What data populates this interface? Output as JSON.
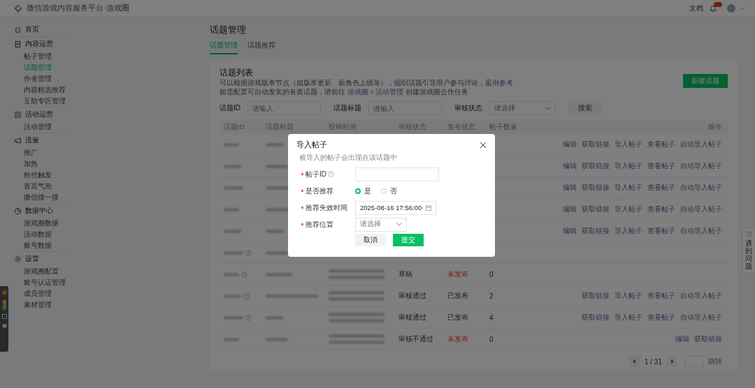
{
  "header": {
    "title": "微信游戏内容服务平台·游戏圈",
    "docs_link": "文档"
  },
  "sidebar": {
    "groups": [
      {
        "label": "首页"
      },
      {
        "label": "内容运营",
        "items": [
          {
            "label": "帖子管理",
            "selected": false
          },
          {
            "label": "话题管理",
            "selected": true
          },
          {
            "label": "作者管理",
            "selected": false
          },
          {
            "label": "内容精选推荐",
            "selected": false
          },
          {
            "label": "互助专区管理",
            "selected": false
          }
        ]
      },
      {
        "label": "活动运营",
        "items": [
          {
            "label": "活动管理",
            "selected": false
          }
        ]
      },
      {
        "label": "流量",
        "items": [
          {
            "label": "推广",
            "selected": false
          },
          {
            "label": "加热",
            "selected": false
          },
          {
            "label": "粉丝触发",
            "selected": false
          },
          {
            "label": "首页气泡",
            "selected": false
          },
          {
            "label": "微信搜一搜",
            "selected": false
          }
        ]
      },
      {
        "label": "数据中心",
        "items": [
          {
            "label": "游戏圈数据",
            "selected": false
          },
          {
            "label": "活动数据",
            "selected": false
          },
          {
            "label": "账号数据",
            "selected": false
          }
        ]
      },
      {
        "label": "设置",
        "items": [
          {
            "label": "游戏圈配置",
            "selected": false
          },
          {
            "label": "账号认证管理",
            "selected": false
          },
          {
            "label": "成员管理",
            "selected": false
          },
          {
            "label": "素材管理",
            "selected": false
          }
        ]
      }
    ]
  },
  "page_title": "话题管理",
  "tabs": [
    {
      "label": "话题管理",
      "selected": true
    },
    {
      "label": "话题推荐",
      "selected": false
    }
  ],
  "card": {
    "title": "话题列表",
    "new_button": "新建话题",
    "description": [
      {
        "text": "可以根据游戏版本节点（如版本更新、新角色上线等），组织话题引导用户参与讨论，",
        "link": "案例参考"
      },
      {
        "text": "如需配置可自动发奖的有奖话题，请前往 ",
        "link": "游戏圈 > 活动管理",
        "after": " 创建游戏圈合作任务"
      }
    ],
    "filters": [
      {
        "kind": "input",
        "label": "话题ID",
        "placeholder": "请输入"
      },
      {
        "kind": "input",
        "label": "话题标题",
        "placeholder": "请输入"
      },
      {
        "kind": "select",
        "label": "审核状态",
        "placeholder": "请选择"
      }
    ],
    "search_button": "搜索",
    "columns": [
      "话题ID",
      "话题标题",
      "投稿时间",
      "审核状态",
      "发布状态",
      "帖子数量",
      "操作"
    ],
    "rows": [
      {
        "help": false,
        "actions": [
          "编辑",
          "获取链接",
          "导入帖子",
          "查看帖子",
          "自动导入帖子"
        ]
      },
      {
        "help": false,
        "actions": [
          "编辑",
          "获取链接",
          "导入帖子",
          "查看帖子",
          "自动导入帖子"
        ]
      },
      {
        "help": false,
        "actions": [
          "编辑",
          "获取链接",
          "导入帖子",
          "查看帖子",
          "自动导入帖子"
        ]
      },
      {
        "help": false,
        "actions": [
          "编辑",
          "获取链接",
          "导入帖子",
          "查看帖子",
          "自动导入帖子"
        ]
      },
      {
        "help": false,
        "actions": [
          "编辑",
          "获取链接",
          "导入帖子",
          "查看帖子",
          "自动导入帖子"
        ]
      },
      {
        "help": true,
        "actions": []
      },
      {
        "help": true,
        "audit": "草稿",
        "publish": "未发布",
        "published": false,
        "count": "0",
        "actions": []
      },
      {
        "help": true,
        "audit": "审核通过",
        "publish": "已发布",
        "published": true,
        "count": "2",
        "actions": [
          "获取链接",
          "导入帖子",
          "查看帖子",
          "自动导入帖子"
        ]
      },
      {
        "help": true,
        "audit": "审核通过",
        "publish": "已发布",
        "published": true,
        "count": "4",
        "actions": [
          "获取链接",
          "导入帖子",
          "查看帖子",
          "自动导入帖子"
        ]
      },
      {
        "help": false,
        "audit": "审核不通过",
        "publish": "未发布",
        "published": false,
        "count": "0",
        "actions": [
          "编辑",
          "获取链接"
        ]
      }
    ],
    "pagination": {
      "page": "1 / 31",
      "jump": "跳转"
    }
  },
  "help_tab": {
    "label": "遇到问题"
  },
  "modal": {
    "title": "导入帖子",
    "hint": "被导入的帖子会出现在该话题中",
    "fields": [
      {
        "kind": "input",
        "label": "帖子ID",
        "required": true,
        "help": true
      },
      {
        "kind": "radio",
        "label": "是否推荐",
        "required": true,
        "options": [
          {
            "label": "是",
            "selected": true
          },
          {
            "label": "否",
            "selected": false
          }
        ]
      },
      {
        "kind": "date",
        "label": "推荐失效时间",
        "required": true,
        "value": "2025-08-16 17:56:00"
      },
      {
        "kind": "select",
        "label": "推荐位置",
        "required": true,
        "placeholder": "请选择"
      }
    ],
    "buttons": [
      {
        "label": "取消",
        "primary": false
      },
      {
        "label": "提交",
        "primary": true
      }
    ]
  }
}
